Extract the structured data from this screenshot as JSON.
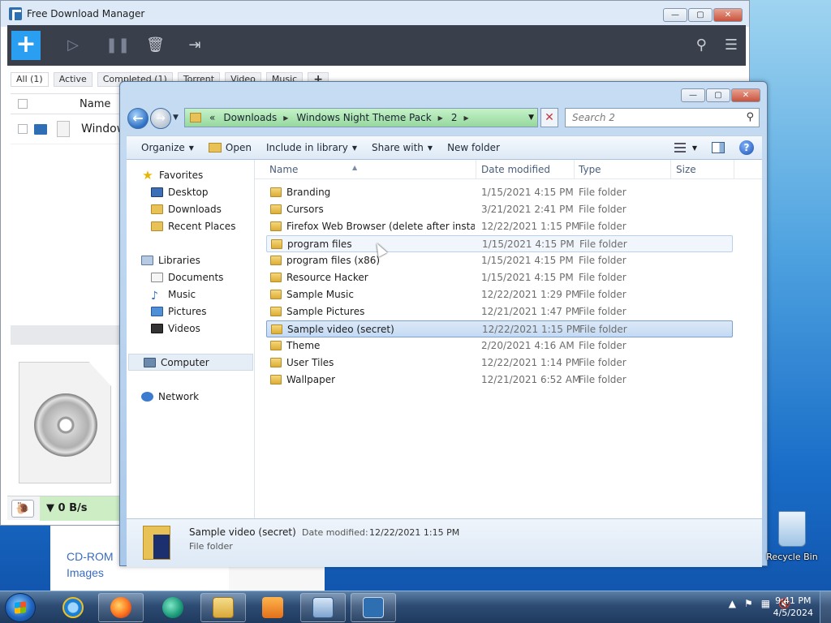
{
  "fdm": {
    "title": "Free Download Manager",
    "tabs": [
      "All (1)",
      "Active",
      "Completed (1)",
      "Torrent",
      "Video",
      "Music"
    ],
    "add_tab": "+",
    "column_name": "Name",
    "row_name": "Windows",
    "speed": "0 B/s"
  },
  "behind": {
    "cdrom_line1": "CD-ROM",
    "cdrom_line2": "Images"
  },
  "explorer": {
    "breadcrumb_prefix": "«",
    "breadcrumb": [
      "Downloads",
      "Windows Night Theme Pack",
      "2"
    ],
    "search_placeholder": "Search 2",
    "commands": {
      "organize": "Organize",
      "open": "Open",
      "include": "Include in library",
      "share": "Share with",
      "new_folder": "New folder"
    },
    "nav": {
      "favorites": "Favorites",
      "favorites_items": [
        "Desktop",
        "Downloads",
        "Recent Places"
      ],
      "libraries": "Libraries",
      "libraries_items": [
        "Documents",
        "Music",
        "Pictures",
        "Videos"
      ],
      "computer": "Computer",
      "network": "Network"
    },
    "columns": {
      "name": "Name",
      "date": "Date modified",
      "type": "Type",
      "size": "Size"
    },
    "files": [
      {
        "name": "Branding",
        "date": "1/15/2021 4:15 PM",
        "type": "File folder"
      },
      {
        "name": "Cursors",
        "date": "3/21/2021 2:41 PM",
        "type": "File folder"
      },
      {
        "name": "Firefox Web Browser (delete after installat...",
        "date": "12/22/2021 1:15 PM",
        "type": "File folder"
      },
      {
        "name": "program files",
        "date": "1/15/2021 4:15 PM",
        "type": "File folder"
      },
      {
        "name": "program files (x86)",
        "date": "1/15/2021 4:15 PM",
        "type": "File folder"
      },
      {
        "name": "Resource Hacker",
        "date": "1/15/2021 4:15 PM",
        "type": "File folder"
      },
      {
        "name": "Sample Music",
        "date": "12/22/2021 1:29 PM",
        "type": "File folder"
      },
      {
        "name": "Sample Pictures",
        "date": "12/21/2021 1:47 PM",
        "type": "File folder"
      },
      {
        "name": "Sample video (secret)",
        "date": "12/22/2021 1:15 PM",
        "type": "File folder"
      },
      {
        "name": "Theme",
        "date": "2/20/2021 4:16 AM",
        "type": "File folder"
      },
      {
        "name": "User Tiles",
        "date": "12/22/2021 1:14 PM",
        "type": "File folder"
      },
      {
        "name": "Wallpaper",
        "date": "12/21/2021 6:52 AM",
        "type": "File folder"
      }
    ],
    "details": {
      "name": "Sample video (secret)",
      "modified_label": "Date modified:",
      "modified": "12/22/2021 1:15 PM",
      "type": "File folder"
    }
  },
  "desktop": {
    "recycle_bin": "Recycle Bin"
  },
  "taskbar": {
    "time": "9:41 PM",
    "date": "4/5/2024",
    "apps": [
      "internet-explorer",
      "firefox",
      "browser-app",
      "windows-explorer",
      "media-player",
      "control-panel",
      "free-download-manager"
    ]
  },
  "colors": {
    "fdm_toolbar": "#3a3f4c",
    "fdm_accent": "#2a9ef0",
    "address_bar": "#96d89e",
    "selection": "#c4daf3"
  }
}
